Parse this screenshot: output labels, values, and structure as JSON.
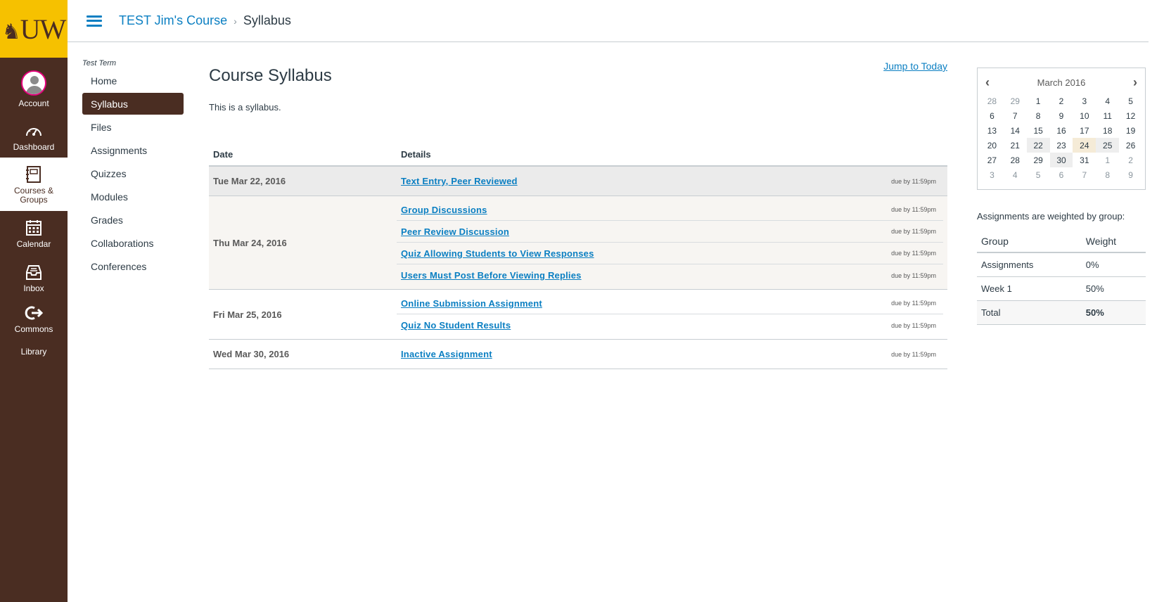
{
  "global_nav": {
    "logo_text": "UW",
    "items": [
      {
        "label": "Account",
        "icon": "avatar-icon"
      },
      {
        "label": "Dashboard",
        "icon": "dashboard-icon"
      },
      {
        "label": "Courses &",
        "label2": "Groups",
        "icon": "courses-icon"
      },
      {
        "label": "Calendar",
        "icon": "calendar-icon"
      },
      {
        "label": "Inbox",
        "icon": "inbox-icon"
      },
      {
        "label": "Commons",
        "icon": "commons-icon"
      },
      {
        "label": "Library",
        "icon": ""
      }
    ]
  },
  "breadcrumb": {
    "course": "TEST Jim's Course",
    "separator": "›",
    "current": "Syllabus"
  },
  "course_nav": {
    "term": "Test Term",
    "items": [
      "Home",
      "Syllabus",
      "Files",
      "Assignments",
      "Quizzes",
      "Modules",
      "Grades",
      "Collaborations",
      "Conferences"
    ],
    "active": "Syllabus"
  },
  "main": {
    "title": "Course Syllabus",
    "jump_link": "Jump to Today",
    "intro": "This is a syllabus.",
    "table": {
      "headers": {
        "date": "Date",
        "details": "Details"
      },
      "groups": [
        {
          "date": "Tue Mar 22, 2016",
          "items": [
            {
              "name": "Text Entry, Peer Reviewed",
              "due": "due by 11:59pm"
            }
          ]
        },
        {
          "date": "Thu Mar 24, 2016",
          "items": [
            {
              "name": "Group Discussions",
              "due": "due by 11:59pm"
            },
            {
              "name": "Peer Review Discussion",
              "due": "due by 11:59pm"
            },
            {
              "name": "Quiz Allowing Students to View Responses",
              "due": "due by 11:59pm"
            },
            {
              "name": "Users Must Post Before Viewing Replies",
              "due": "due by 11:59pm"
            }
          ]
        },
        {
          "date": "Fri Mar 25, 2016",
          "items": [
            {
              "name": "Online Submission Assignment",
              "due": "due by 11:59pm"
            },
            {
              "name": "Quiz No Student Results",
              "due": "due by 11:59pm"
            }
          ]
        },
        {
          "date": "Wed Mar 30, 2016",
          "items": [
            {
              "name": "Inactive Assignment",
              "due": "due by 11:59pm"
            }
          ]
        }
      ]
    }
  },
  "calendar": {
    "month": "March 2016",
    "prev": "‹",
    "next": "›",
    "weeks": [
      [
        "28",
        "29",
        "1",
        "2",
        "3",
        "4",
        "5"
      ],
      [
        "6",
        "7",
        "8",
        "9",
        "10",
        "11",
        "12"
      ],
      [
        "13",
        "14",
        "15",
        "16",
        "17",
        "18",
        "19"
      ],
      [
        "20",
        "21",
        "22",
        "23",
        "24",
        "25",
        "26"
      ],
      [
        "27",
        "28",
        "29",
        "30",
        "31",
        "1",
        "2"
      ],
      [
        "3",
        "4",
        "5",
        "6",
        "7",
        "8",
        "9"
      ]
    ]
  },
  "weights": {
    "caption": "Assignments are weighted by group:",
    "headers": {
      "group": "Group",
      "weight": "Weight"
    },
    "rows": [
      {
        "group": "Assignments",
        "weight": "0%"
      },
      {
        "group": "Week 1",
        "weight": "50%"
      },
      {
        "group": "Total",
        "weight": "50%"
      }
    ]
  },
  "colors": {
    "brand_brown": "#4a2d22",
    "brand_gold": "#f6c100",
    "link_blue": "#0b7fc2"
  }
}
